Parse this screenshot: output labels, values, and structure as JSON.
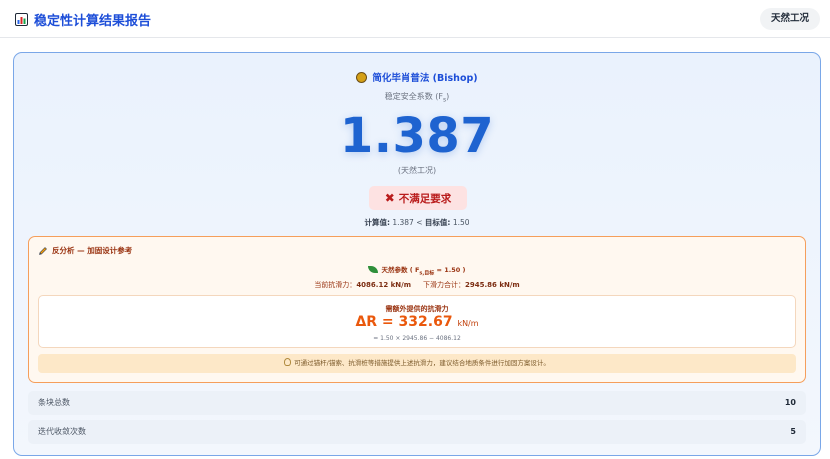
{
  "header": {
    "title": "稳定性计算结果报告",
    "title_icon": "bar-chart-icon",
    "condition_badge": "天然工况"
  },
  "result": {
    "method_icon": "cowboy-emoji-icon",
    "method": "简化毕肖普法 (Bishop)",
    "fs_label": "稳定安全系数 (F",
    "fs_label_sub": "s",
    "fs_label_end": ")",
    "fs_value": "1.387",
    "condition": "(天然工况)",
    "status_icon": "cross-mark-icon",
    "status": "不满足要求",
    "calc_prefix": "计算值:",
    "calc_value": "1.387",
    "calc_op": "<",
    "target_prefix": "目标值:",
    "target_value": "1.50"
  },
  "back_analysis": {
    "title": "反分析 — 加固设计参考",
    "params_label": "天然参数 ( F",
    "params_sub": "s,目标",
    "params_value": "= 1.50 )",
    "resist_label": "当前抗滑力：",
    "resist_value": "4086.12 kN/m",
    "slide_label": "下滑力合计：",
    "slide_value": "2945.86 kN/m",
    "delta_label": "需额外提供的抗滑力",
    "delta_value": "ΔR = 332.67",
    "delta_unit": "kN/m",
    "delta_formula": "= 1.50 × 2945.86 − 4086.12",
    "tip": "可通过锚杆/锚索、抗滑桩等措施提供上述抗滑力，建议结合地质条件进行加固方案设计。"
  },
  "stats": [
    {
      "label": "条块总数",
      "value": "10"
    },
    {
      "label": "迭代收敛次数",
      "value": "5"
    }
  ],
  "colors": {
    "accent": "#1d4ed8",
    "fs_value": "#1e63d0",
    "fail": "#b91c1c",
    "warning_border": "#f59e5b",
    "delta": "#ea580c"
  }
}
